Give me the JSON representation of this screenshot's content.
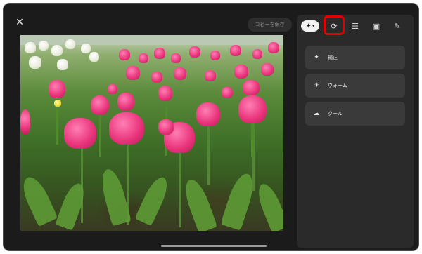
{
  "toolbar": {
    "close_icon": "close-icon",
    "save_label": "コピーを保存"
  },
  "tabs": [
    {
      "name": "enhance-tab",
      "icon": "✦"
    },
    {
      "name": "crop-rotate-tab",
      "icon": "⟳"
    },
    {
      "name": "adjust-tab",
      "icon": "☰"
    },
    {
      "name": "filter-tab",
      "icon": "▣"
    },
    {
      "name": "markup-tab",
      "icon": "✎"
    }
  ],
  "options": [
    {
      "name": "option-auto",
      "icon": "✦",
      "label": "補正"
    },
    {
      "name": "option-warm",
      "icon": "☀",
      "label": "ウォーム"
    },
    {
      "name": "option-cool",
      "icon": "☁",
      "label": "クール"
    }
  ],
  "colors": {
    "highlight": "#e00000"
  }
}
